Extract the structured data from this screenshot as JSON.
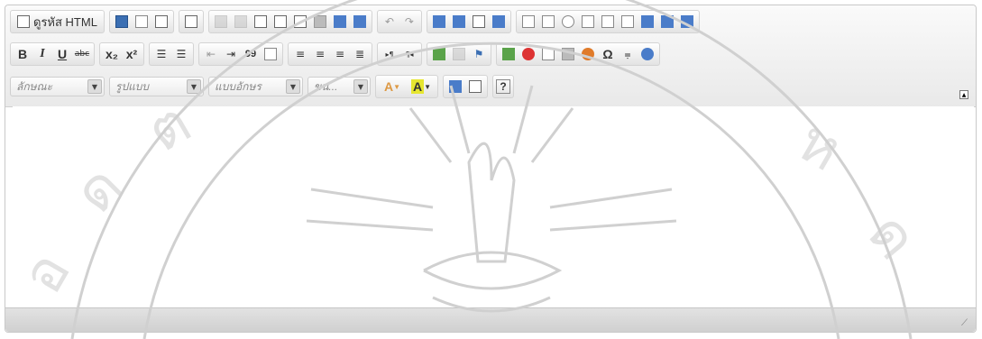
{
  "editor": {
    "source_button_label": "ดูรหัส HTML",
    "format_combos": [
      {
        "label": "ลักษณะ"
      },
      {
        "label": "รูปแบบ"
      },
      {
        "label": "แบบอักษร"
      },
      {
        "label": "ขน..."
      }
    ],
    "icons": {
      "bold": "B",
      "italic": "I",
      "underline": "U",
      "strike": "abc",
      "subscript": "x₂",
      "superscript": "x²",
      "omega": "Ω",
      "font_color": "A",
      "bg_color": "A",
      "help": "?",
      "quote": "99",
      "ltr": "▸¶",
      "rtl": "¶◂"
    },
    "accent_color": "#3b6fb3"
  }
}
